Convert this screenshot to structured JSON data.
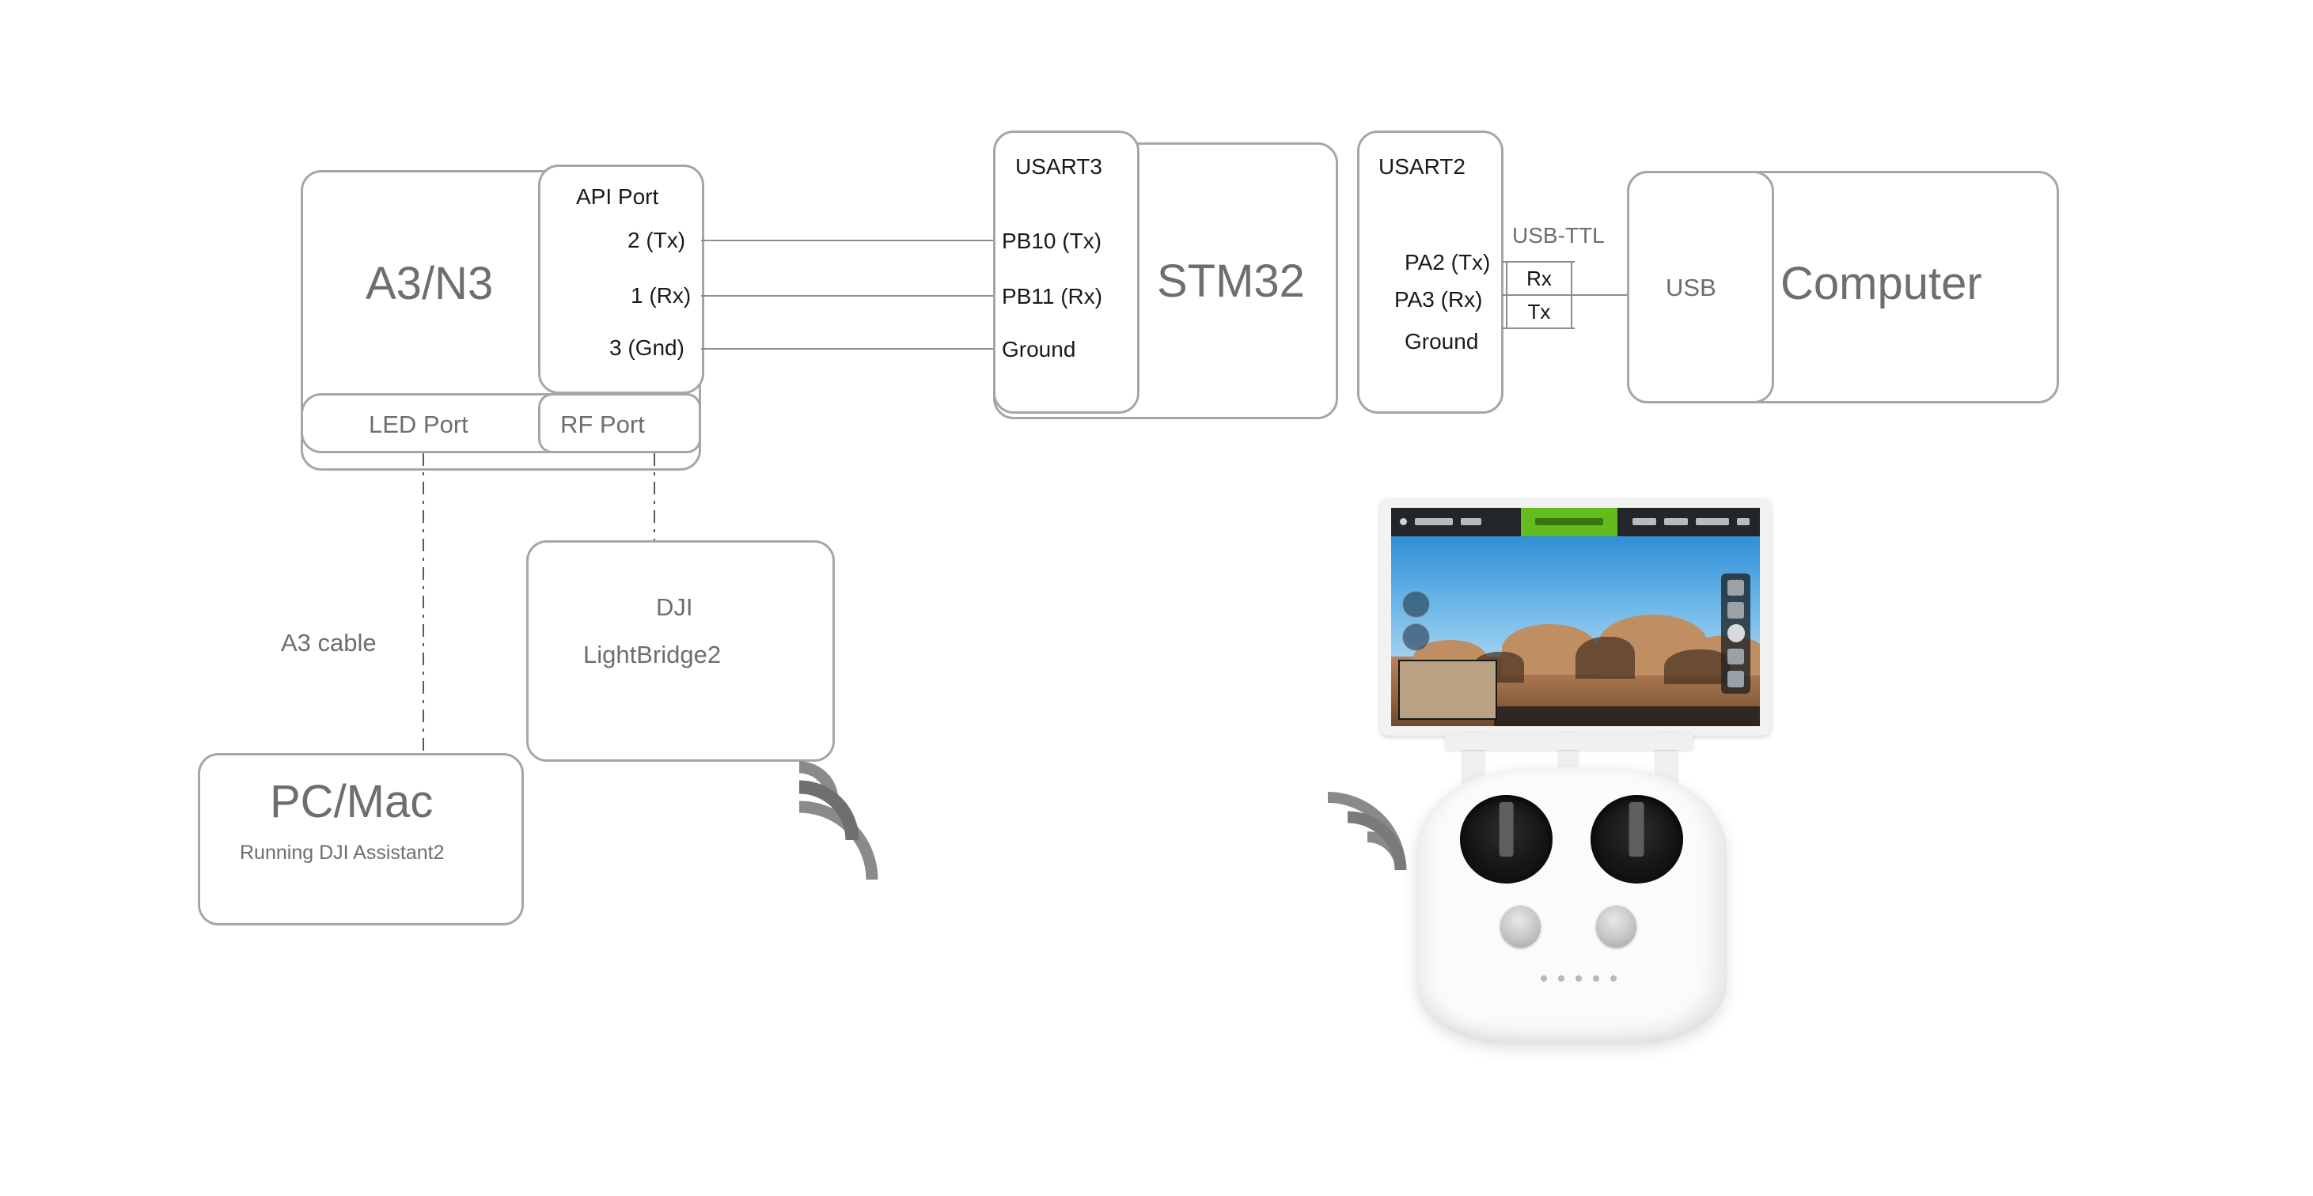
{
  "diagram": {
    "title": "DJI A3/N3 to STM32 to Computer wiring diagram",
    "colors": {
      "box_border": "#a6a6a6",
      "wire": "#8c8c8c",
      "label_gray": "#6e6e6e",
      "label_dark": "#1a1a1a",
      "accent_green": "#63bc1d"
    }
  },
  "flight_controller": {
    "name": "A3/N3",
    "api_port": {
      "title": "API Port",
      "pins": [
        {
          "label": "2 (Tx)"
        },
        {
          "label": "1 (Rx)"
        },
        {
          "label": "3 (Gnd)"
        }
      ]
    },
    "led_port": {
      "label": "LED Port"
    },
    "rf_port": {
      "label": "RF Port"
    }
  },
  "mcu": {
    "name": "STM32",
    "usart3": {
      "title": "USART3",
      "pins": [
        {
          "label": "PB10 (Tx)"
        },
        {
          "label": "PB11 (Rx)"
        },
        {
          "label": "Ground"
        }
      ]
    },
    "usart2": {
      "title": "USART2",
      "pins": [
        {
          "label": "PA2 (Tx)"
        },
        {
          "label": "PA3 (Rx)"
        },
        {
          "label": "Ground"
        }
      ]
    }
  },
  "usb_ttl": {
    "title": "USB-TTL",
    "rows": [
      {
        "label": "Rx"
      },
      {
        "label": "Tx"
      }
    ]
  },
  "computer": {
    "name": "Computer",
    "port": {
      "label": "USB"
    }
  },
  "pc_mac": {
    "name": "PC/Mac",
    "subtitle": "Running DJI Assistant2"
  },
  "cables": {
    "a3_cable": {
      "label": "A3 cable"
    }
  },
  "lightbridge": {
    "line1": "DJI",
    "line2": "LightBridge2"
  },
  "icons": {
    "wifi_lightbridge": "wireless-signal-icon",
    "wifi_remote": "wireless-signal-icon"
  },
  "remote_controller": {
    "name": "DJI remote controller with mounted tablet",
    "tablet": {
      "name": "tablet-running-dji-go-app"
    }
  }
}
